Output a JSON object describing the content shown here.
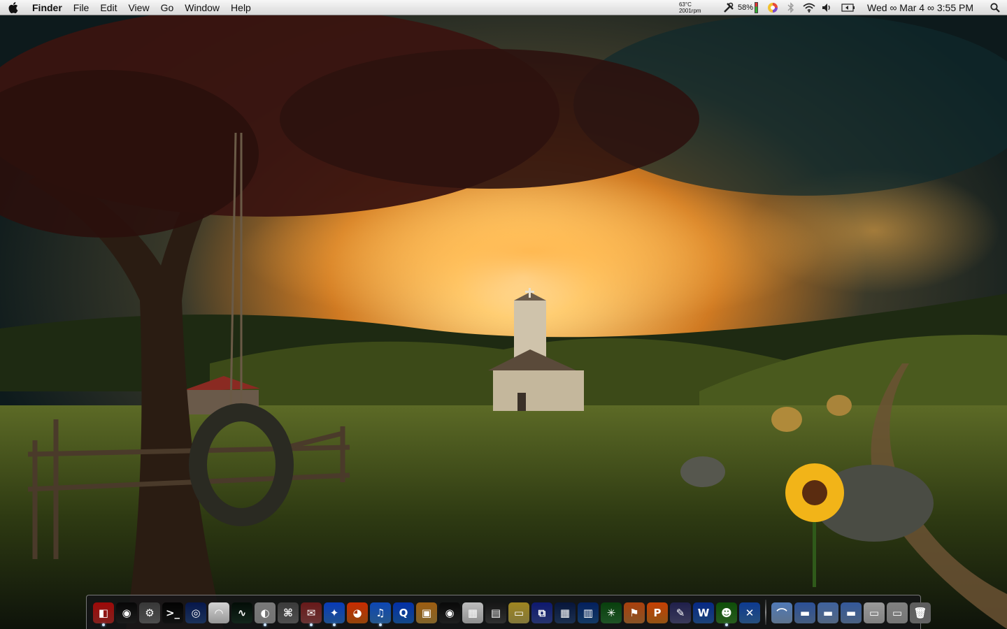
{
  "menubar": {
    "apple_icon": "apple-logo-icon",
    "app_name": "Finder",
    "menus": [
      "File",
      "Edit",
      "View",
      "Go",
      "Window",
      "Help"
    ],
    "status": {
      "temperature": "63°C",
      "fan_speed": "2001rpm",
      "battery_percent": "58%",
      "clock": "Wed ∞ Mar 4 ∞ 3:55 PM"
    }
  },
  "dock": {
    "items": [
      {
        "icon": "finder-icon",
        "running": true,
        "color": "#c8322e",
        "glyph": "◧"
      },
      {
        "icon": "dashboard-icon",
        "running": false,
        "color": "#2b2b2b",
        "glyph": "◉"
      },
      {
        "icon": "system-preferences-icon",
        "running": false,
        "color": "#777777",
        "glyph": "⚙"
      },
      {
        "icon": "terminal-icon",
        "running": false,
        "color": "#1b1b1b",
        "glyph": ">_"
      },
      {
        "icon": "time-machine-icon",
        "running": false,
        "color": "#2a4d8a",
        "glyph": "◎"
      },
      {
        "icon": "airport-utility-icon",
        "running": false,
        "color": "#e8e8e8",
        "glyph": "◠"
      },
      {
        "icon": "activity-monitor-icon",
        "running": false,
        "color": "#1d3a2a",
        "glyph": "∿"
      },
      {
        "icon": "disk-utility-icon",
        "running": true,
        "color": "#b0b0b0",
        "glyph": "◐"
      },
      {
        "icon": "network-utility-icon",
        "running": false,
        "color": "#7a7a7a",
        "glyph": "⌘"
      },
      {
        "icon": "stamp-icon",
        "running": true,
        "color": "#a25050",
        "glyph": "✉"
      },
      {
        "icon": "safari-icon",
        "running": true,
        "color": "#2f7bd9",
        "glyph": "✦"
      },
      {
        "icon": "firefox-icon",
        "running": false,
        "color": "#e26a12",
        "glyph": "◕"
      },
      {
        "icon": "itunes-icon",
        "running": true,
        "color": "#3a86d6",
        "glyph": "♫"
      },
      {
        "icon": "quicktime-icon",
        "running": false,
        "color": "#1e6fcf",
        "glyph": "Q"
      },
      {
        "icon": "iphoto-icon",
        "running": false,
        "color": "#c89a42",
        "glyph": "▣"
      },
      {
        "icon": "photo-booth-icon",
        "running": false,
        "color": "#303030",
        "glyph": "◉"
      },
      {
        "icon": "calendar-icon",
        "running": false,
        "color": "#dcdcdc",
        "glyph": "▦"
      },
      {
        "icon": "cinema-display-icon",
        "running": false,
        "color": "#4a4a4a",
        "glyph": "▤"
      },
      {
        "icon": "disk-drive-icon",
        "running": false,
        "color": "#c9b85a",
        "glyph": "▭"
      },
      {
        "icon": "network-connect-icon",
        "running": false,
        "color": "#3b4fa8",
        "glyph": "⧉"
      },
      {
        "icon": "spaces-icon",
        "running": false,
        "color": "#2b4a7a",
        "glyph": "▦"
      },
      {
        "icon": "numbers-icon",
        "running": false,
        "color": "#1f5a9a",
        "glyph": "▥"
      },
      {
        "icon": "twitterrific-icon",
        "running": false,
        "color": "#2f7f3a",
        "glyph": "✳"
      },
      {
        "icon": "bird-app-icon",
        "running": false,
        "color": "#d0803a",
        "glyph": "⚑"
      },
      {
        "icon": "pages-icon",
        "running": false,
        "color": "#e0801e",
        "glyph": "P"
      },
      {
        "icon": "scripts-icon",
        "running": false,
        "color": "#5a5a8a",
        "glyph": "✎"
      },
      {
        "icon": "wunderlist-icon",
        "running": false,
        "color": "#2a66b8",
        "glyph": "W"
      },
      {
        "icon": "adium-icon",
        "running": true,
        "color": "#3d8d2f",
        "glyph": "☻"
      },
      {
        "icon": "x11-icon",
        "running": false,
        "color": "#3b7ac0",
        "glyph": "✕"
      },
      {
        "separator": true
      },
      {
        "icon": "applications-stack-icon",
        "running": false,
        "color": "#8fb0d8",
        "glyph": "⌒"
      },
      {
        "icon": "documents-folder-icon",
        "running": false,
        "color": "#6a8fc4",
        "glyph": "▬"
      },
      {
        "icon": "downloads-folder-icon",
        "running": false,
        "color": "#7f9ec8",
        "glyph": "▬"
      },
      {
        "icon": "app-store-folder-icon",
        "running": false,
        "color": "#7396c6",
        "glyph": "▬"
      },
      {
        "icon": "finder-window-stack-icon",
        "running": false,
        "color": "#c6c6c6",
        "glyph": "▭"
      },
      {
        "icon": "mail-stack-icon",
        "running": false,
        "color": "#b5b5b5",
        "glyph": "▭"
      },
      {
        "icon": "trash-icon",
        "running": false,
        "color": "#9a9a9a",
        "glyph": "🗑"
      }
    ]
  }
}
